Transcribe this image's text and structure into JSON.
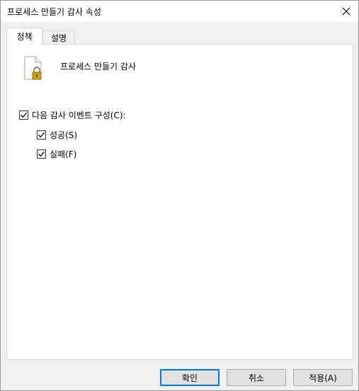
{
  "window": {
    "title": "프로세스 만들기 감사 속성"
  },
  "tabs": [
    {
      "label": "정책",
      "active": true
    },
    {
      "label": "설명",
      "active": false
    }
  ],
  "policy": {
    "icon": "file-lock-icon",
    "name": "프로세스 만들기 감사"
  },
  "audit": {
    "configure_label": "다음 감사 이벤트 구성(C):",
    "configure_checked": true,
    "success_label": "성공(S)",
    "success_checked": true,
    "failure_label": "실패(F)",
    "failure_checked": true
  },
  "buttons": {
    "ok": "확인",
    "cancel": "취소",
    "apply": "적용(A)"
  },
  "colors": {
    "accent": "#0078d7",
    "lock": "#d4a017"
  }
}
